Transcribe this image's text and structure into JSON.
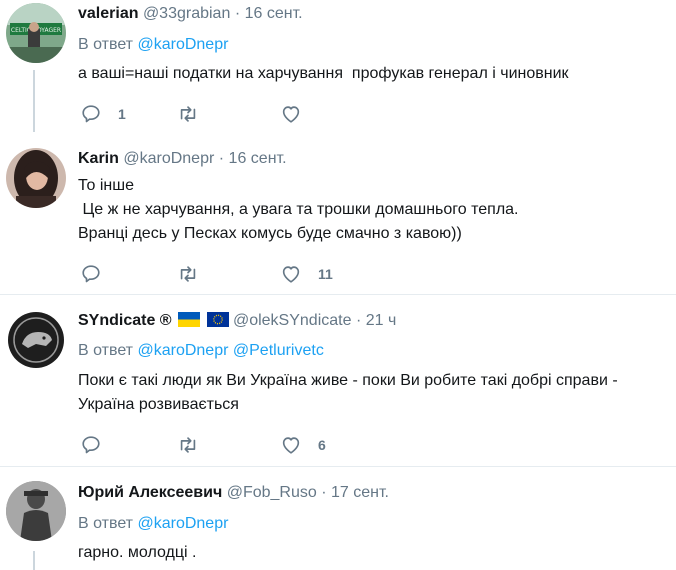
{
  "tweets": [
    {
      "fullname": "valerian",
      "handle": "@33grabian",
      "dot": "·",
      "time": "16 сент.",
      "reply_prefix": "В ответ",
      "reply_mentions": [
        "@karoDnepr"
      ],
      "text": "а ваші=наші податки на харчування  профукав генерал і чиновник",
      "counts": {
        "reply": "1",
        "retweet": "",
        "like": ""
      }
    },
    {
      "fullname": "Karin",
      "handle": "@karoDnepr",
      "dot": "·",
      "time": "16 сент.",
      "text": "То інше\n Це ж не харчування, а увага та трошки домашнього тепла.\nВранці десь у Песках комусь буде смачно з кавою))",
      "counts": {
        "reply": "",
        "retweet": "",
        "like": "11"
      }
    },
    {
      "fullname": "SYndicate ®",
      "handle": "@olekSYndicate",
      "dot": "·",
      "time": "21 ч",
      "reply_prefix": "В ответ",
      "reply_mentions": [
        "@karoDnepr",
        "@Petlurivetc"
      ],
      "text": "Поки є такі люди як Ви Україна живе - поки Ви робите такі добрі справи -\nУкраїна розвивається",
      "counts": {
        "reply": "",
        "retweet": "",
        "like": "6"
      }
    },
    {
      "fullname": "Юрий Алексеевич",
      "handle": "@Fob_Ruso",
      "dot": "·",
      "time": "17 сент.",
      "reply_prefix": "В ответ",
      "reply_mentions": [
        "@karoDnepr"
      ],
      "text": "гарно. молодці ."
    }
  ],
  "icons": {
    "reply": "reply-icon",
    "retweet": "retweet-icon",
    "like": "heart-icon",
    "flags": [
      "ukraine-flag-icon",
      "eu-flag-icon"
    ]
  },
  "colors": {
    "text": "#14171a",
    "secondary": "#657786",
    "link": "#1da1f2",
    "divider": "#e6ecf0",
    "thread_line": "#ccd6dd"
  }
}
